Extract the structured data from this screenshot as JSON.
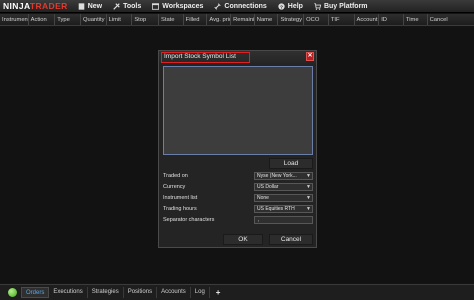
{
  "menubar": {
    "logo_ninja": "NINJA",
    "logo_trader": "TRADER",
    "items": [
      {
        "label": "New",
        "icon": "new-icon"
      },
      {
        "label": "Tools",
        "icon": "tools-icon"
      },
      {
        "label": "Workspaces",
        "icon": "workspaces-icon"
      },
      {
        "label": "Connections",
        "icon": "connections-icon"
      },
      {
        "label": "Help",
        "icon": "help-icon"
      },
      {
        "label": "Buy Platform",
        "icon": "buy-platform-icon"
      }
    ]
  },
  "columns": [
    "Instrument",
    "Action",
    "Type",
    "Quantity",
    "Limit",
    "Stop",
    "State",
    "Filled",
    "Avg. price",
    "Remaining",
    "Name",
    "Strategy",
    "OCO",
    "TIF",
    "Account",
    "ID",
    "Time",
    "Cancel"
  ],
  "dialog": {
    "title": "Import Stock Symbol List",
    "close_glyph": "✕",
    "load_label": "Load",
    "fields": {
      "traded_on": {
        "label": "Traded on",
        "value": "Nyse (New York..."
      },
      "currency": {
        "label": "Currency",
        "value": "US Dollar"
      },
      "instrument_list": {
        "label": "Instrument list",
        "value": "None"
      },
      "trading_hours": {
        "label": "Trading hours",
        "value": "US Equities RTH"
      },
      "separator": {
        "label": "Separator characters",
        "value": ","
      }
    },
    "ok_label": "OK",
    "cancel_label": "Cancel"
  },
  "tabs": [
    {
      "label": "Orders",
      "active": true
    },
    {
      "label": "Executions",
      "active": false
    },
    {
      "label": "Strategies",
      "active": false
    },
    {
      "label": "Positions",
      "active": false
    },
    {
      "label": "Accounts",
      "active": false
    },
    {
      "label": "Log",
      "active": false
    }
  ],
  "add_tab_label": "+",
  "colors": {
    "accent": "#e02020",
    "active_tab_text": "#5aa7e8",
    "status": "#3ea81a"
  }
}
